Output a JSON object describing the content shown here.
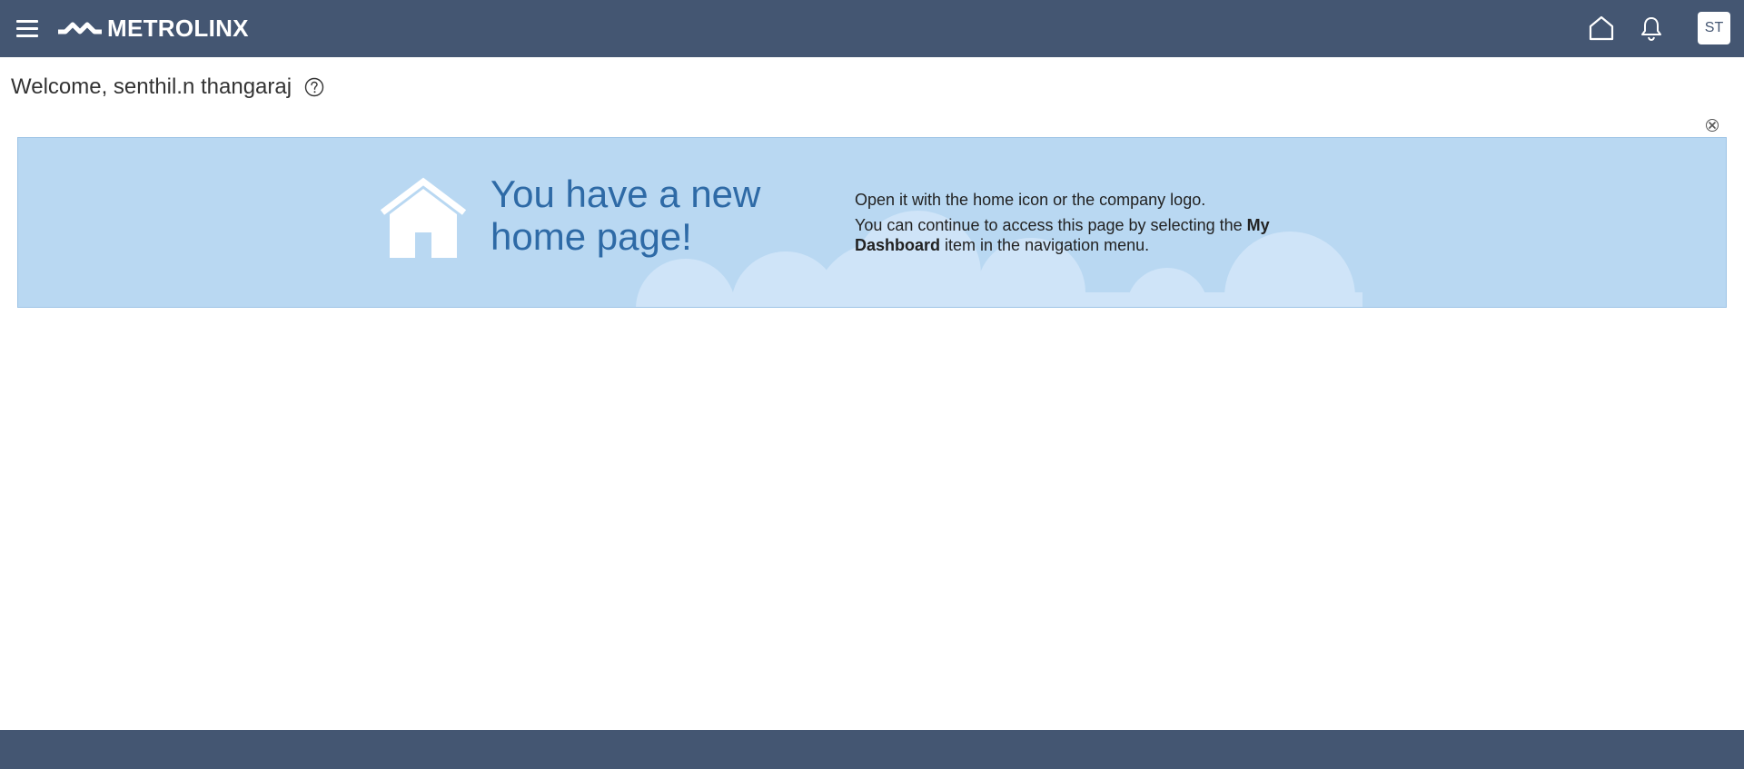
{
  "header": {
    "brand": "METROLINX",
    "avatar_initials": "ST",
    "icons": [
      "menu-icon",
      "home-icon",
      "bell-icon"
    ],
    "background_color": "#445672"
  },
  "welcome": {
    "text": "Welcome, senthil.n thangaraj",
    "help_icon": "question-circle-icon"
  },
  "banner": {
    "title": "You have a new home page!",
    "line1": "Open it with the home icon or the company logo.",
    "line2_prefix": "You can continue to access this page by selecting the ",
    "line2_bold": "My Dashboard",
    "line2_suffix": " item in the navigation menu.",
    "background_color": "#b9d8f2",
    "title_color": "#2e6aa6",
    "dismiss_icon": "close-icon"
  }
}
